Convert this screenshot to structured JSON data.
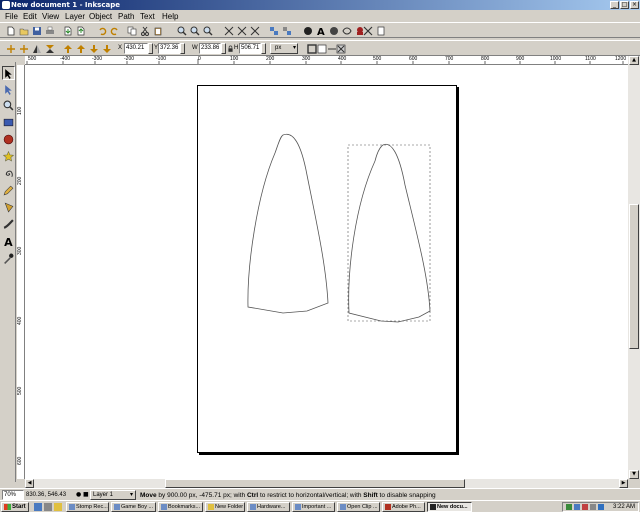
{
  "window": {
    "title": "New document 1 - Inkscape"
  },
  "menu": [
    "File",
    "Edit",
    "View",
    "Layer",
    "Object",
    "Path",
    "Text",
    "Help"
  ],
  "selector_toolbar": {
    "x_label": "X",
    "x_value": "430.21",
    "y_label": "Y",
    "y_value": "372.36",
    "w_label": "W",
    "w_value": "233.86",
    "h_label": "H",
    "h_value": "506.71",
    "unit": "px"
  },
  "rulers": {
    "h_ticks": [
      "500",
      "-400",
      "-300",
      "-200",
      "-100",
      "0",
      "100",
      "200",
      "300",
      "400",
      "500",
      "600",
      "700",
      "800",
      "900",
      "1000",
      "1100",
      "1200"
    ],
    "v_ticks": [
      "100",
      "200",
      "300",
      "400",
      "500",
      "600",
      "700",
      "800",
      "900",
      "1000"
    ]
  },
  "statusbar": {
    "zoom": "70%",
    "coords": "830.36, 546.43",
    "layer": "Layer 1",
    "message_bold": "Move",
    "message_1": " by 900.00 px, -475.71 px; with ",
    "ctrl": "Ctrl",
    "message_2": " to restrict to horizontal/vertical; with ",
    "shift": "Shift",
    "message_3": " to disable snapping"
  },
  "taskbar": {
    "start": "Start",
    "tasks": [
      "Stomp Rec...",
      "Game Boy ...",
      "Bookmarks...",
      "New Folder",
      "Hardware...",
      "Important ...",
      "Open Clip ...",
      "Adobe Ph...",
      "New docu..."
    ],
    "clock": "3:22 AM"
  }
}
